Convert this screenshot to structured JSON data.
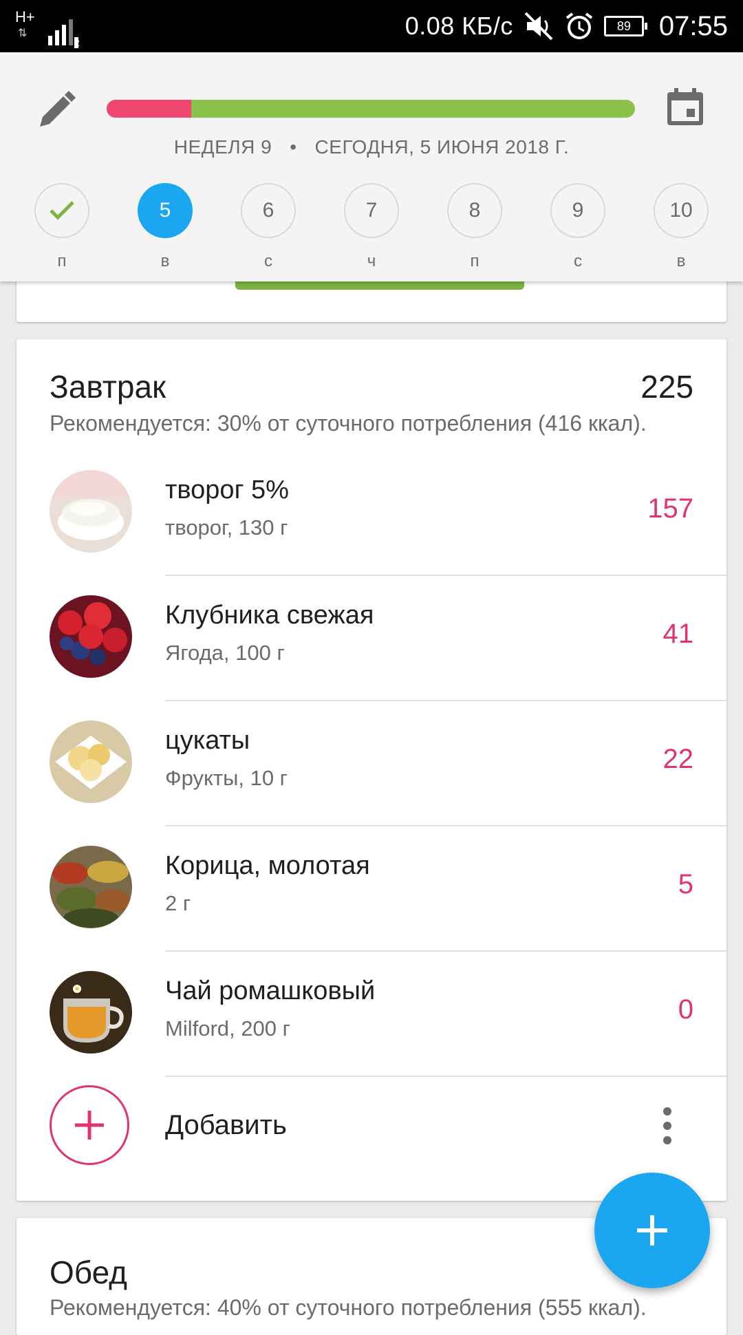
{
  "status_bar": {
    "network": "H+",
    "sim": "2",
    "speed": "0.08 КБ/с",
    "battery": "89",
    "time": "07:55"
  },
  "header": {
    "week_label": "НЕДЕЛЯ 9",
    "separator": "•",
    "date_label": "СЕГОДНЯ, 5 ИЮНЯ 2018 Г.",
    "progress_fraction_red": 0.16,
    "colors": {
      "progress_red": "#ef476f",
      "progress_green": "#8bc34a",
      "accent": "#1aa6f0"
    },
    "days": [
      {
        "number": "",
        "letter": "п",
        "state": "done"
      },
      {
        "number": "5",
        "letter": "в",
        "state": "active"
      },
      {
        "number": "6",
        "letter": "с",
        "state": "default"
      },
      {
        "number": "7",
        "letter": "ч",
        "state": "default"
      },
      {
        "number": "8",
        "letter": "п",
        "state": "default"
      },
      {
        "number": "9",
        "letter": "с",
        "state": "default"
      },
      {
        "number": "10",
        "letter": "в",
        "state": "default"
      }
    ]
  },
  "breakfast": {
    "title": "Завтрак",
    "total": "225",
    "recommendation": "Рекомендуется: 30% от суточного потребления (416 ккал).",
    "items": [
      {
        "name": "творог 5%",
        "detail": "творог, 130 г",
        "kcal": "157",
        "icon": "cottage-cheese-photo"
      },
      {
        "name": "Клубника свежая",
        "detail": "Ягода, 100 г",
        "kcal": "41",
        "icon": "berries-photo"
      },
      {
        "name": "цукаты",
        "detail": "Фрукты, 10 г",
        "kcal": "22",
        "icon": "dried-fruit-photo"
      },
      {
        "name": "Корица, молотая",
        "detail": "2 г",
        "kcal": "5",
        "icon": "spices-photo"
      },
      {
        "name": "Чай ромашковый",
        "detail": "Milford, 200 г",
        "kcal": "0",
        "icon": "tea-photo"
      }
    ],
    "add_label": "Добавить"
  },
  "lunch": {
    "title": "Обед",
    "recommendation": "Рекомендуется: 40% от суточного потребления (555 ккал)."
  }
}
